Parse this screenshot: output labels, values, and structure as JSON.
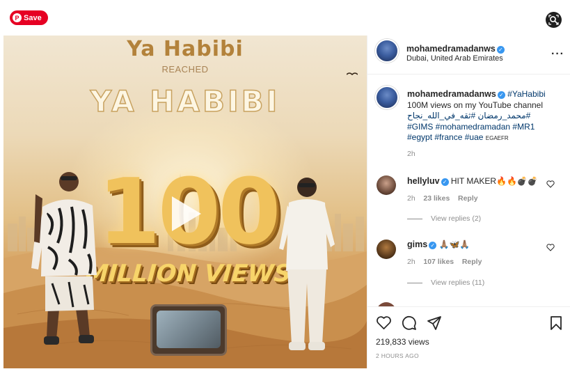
{
  "pin": {
    "save_label": "Save",
    "logo_letter": "P",
    "brand_color": "#e60023"
  },
  "lens": {
    "icon": "visual-search-icon"
  },
  "media": {
    "headline_top": "Ya Habibi",
    "headline_reached": "REACHED",
    "headline_big": "YA HABIBI",
    "big_number": "100",
    "million_text": "MILLION VIEWS",
    "play_icon": "play-icon"
  },
  "post": {
    "author": "mohamedramadanws",
    "verified": true,
    "location": "Dubai, United Arab Emirates",
    "more_icon": "more-options-icon"
  },
  "caption": {
    "username": "mohamedramadanws",
    "hashtag1": "#YaHabibi",
    "line1": "100M views on my YouTube channel",
    "arabic": "#محمد_رمضان #ثقه_في_الله_نجاح",
    "hashtags2": "#GIMS #mohamedramadan #MR1",
    "hashtags3": "#egypt #france #uae",
    "flags": "EGAEFR",
    "time": "2h"
  },
  "comments": [
    {
      "username": "hellyluv",
      "verified": true,
      "text": "HIT MAKER🔥🔥💣💣",
      "time": "2h",
      "likes": "23 likes",
      "reply": "Reply",
      "view_replies": "View replies (2)"
    },
    {
      "username": "gims",
      "verified": true,
      "text": "🙏🏽🦋🙏🏽",
      "time": "2h",
      "likes": "107 likes",
      "reply": "Reply",
      "view_replies": "View replies (11)"
    }
  ],
  "actions": {
    "icons": [
      "heart-icon",
      "comment-icon",
      "share-icon",
      "bookmark-icon"
    ],
    "views": "219,833 views",
    "posted": "2 HOURS AGO"
  },
  "colors": {
    "link": "#00376b",
    "muted": "#8e8e8e",
    "verified": "#3897f0"
  }
}
